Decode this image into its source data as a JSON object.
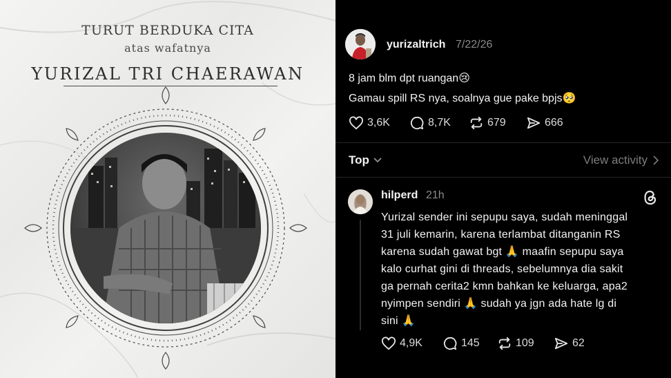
{
  "memorial": {
    "line1": "TURUT BERDUKA CITA",
    "line2": "atas wafatnya",
    "name": "YURIZAL TRI CHAERAWAN"
  },
  "post": {
    "username": "yurizaltrich",
    "date": "7/22/26",
    "line1": "8 jam blm dpt ruangan",
    "line1_emoji": "😢",
    "line2": "Gamau spill RS nya, soalnya gue pake bpjs",
    "line2_emoji": "🥺",
    "likes": "3,6K",
    "comments": "8,7K",
    "reposts": "679",
    "shares": "666"
  },
  "sort": {
    "label": "Top",
    "view_activity": "View activity"
  },
  "reply": {
    "username": "hilperd",
    "time": "21h",
    "lines": [
      "Yurizal sender ini sepupu saya, sudah meninggal",
      "31 juli kemarin, karena terlambat ditanganin RS",
      "karena sudah gawat bgt",
      "maafin sepupu saya",
      "kalo curhat gini di threads, sebelumnya dia sakit",
      "ga pernah cerita2 kmn bahkan ke keluarga, apa2",
      "nyimpen sendiri",
      "sudah ya jgn ada hate lg di",
      "sini"
    ],
    "pray_emoji": "🙏",
    "likes": "4,9K",
    "comments": "145",
    "reposts": "109",
    "shares": "62"
  },
  "icons": {
    "like": "heart-icon",
    "comment": "comment-icon",
    "repost": "repost-icon",
    "share": "share-icon",
    "chevron_down": "chevron-down-icon",
    "chevron_right": "chevron-right-icon",
    "threads": "threads-logo-icon"
  },
  "colors": {
    "background": "#000000",
    "text": "#f3f3f3",
    "muted": "#8a8a8a",
    "memorial_bg": "#f0f0ee"
  }
}
